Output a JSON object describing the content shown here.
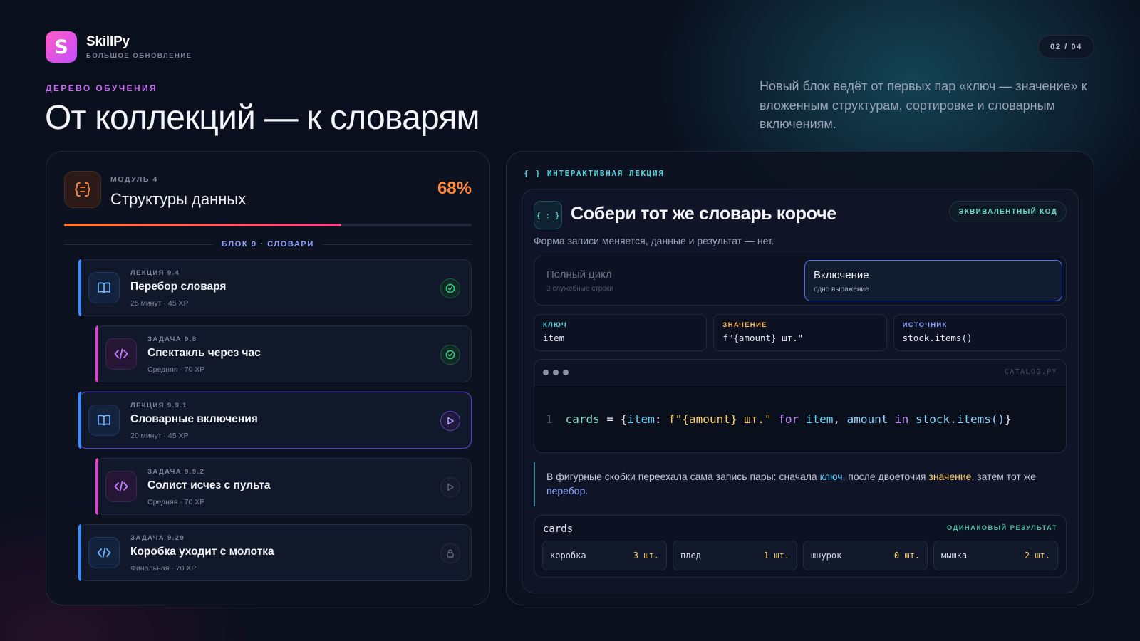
{
  "brand": {
    "name": "SkillPy",
    "subtitle": "БОЛЬШОЕ ОБНОВЛЕНИЕ",
    "logo_letter": "S"
  },
  "pager": "02 / 04",
  "hero": {
    "kicker": "ДЕРЕВО ОБУЧЕНИЯ",
    "title": "От коллекций — к словарям",
    "lede": "Новый блок ведёт от первых пар «ключ — значение» к вложенным структурам, сортировке и словарным включениям."
  },
  "module": {
    "kicker": "МОДУЛЬ 4",
    "title": "Структуры данных",
    "progress_label": "68%",
    "progress": 0.68,
    "icon": "braces-doc-icon",
    "block_label": "БЛОК 9 · СЛОВАРИ",
    "items": [
      {
        "kind": "lesson",
        "kicker": "ЛЕКЦИЯ 9.4",
        "title": "Перебор словаря",
        "meta": "25 минут · 45 XP",
        "status": "done",
        "icon": "book-icon"
      },
      {
        "kind": "task",
        "kicker": "ЗАДАЧА 9.8",
        "title": "Спектакль через час",
        "meta": "Средняя · 70 XP",
        "status": "done",
        "icon": "code-icon"
      },
      {
        "kind": "lesson",
        "kicker": "ЛЕКЦИЯ 9.9.1",
        "title": "Словарные включения",
        "meta": "20 минут · 45 XP",
        "status": "play",
        "icon": "book-icon"
      },
      {
        "kind": "task",
        "kicker": "ЗАДАЧА 9.9.2",
        "title": "Солист исчез с пульта",
        "meta": "Средняя · 70 XP",
        "status": "next",
        "icon": "code-icon"
      },
      {
        "kind": "final",
        "kicker": "ЗАДАЧА 9.20",
        "title": "Коробка уходит с молотка",
        "meta": "Финальная · 70 XP",
        "status": "lock",
        "icon": "code-icon"
      }
    ]
  },
  "lecture": {
    "kicker": "{ }  ИНТЕРАКТИВНАЯ ЛЕКЦИЯ",
    "icon_text": "{ : }",
    "title": "Собери тот же словарь короче",
    "subtitle": "Форма записи меняется, данные и результат — нет.",
    "badge": "ЭКВИВАЛЕНТНЫЙ КОД",
    "options": [
      {
        "label": "Полный цикл",
        "hint": "3 служебные строки",
        "selected": false
      },
      {
        "label": "Включение",
        "hint": "одно выражение",
        "selected": true
      }
    ],
    "fields": [
      {
        "key": "КЛЮЧ",
        "value": "item",
        "color": "#4fd4dc"
      },
      {
        "key": "ЗНАЧЕНИЕ",
        "value": "f\"{amount} шт.\"",
        "color": "#ffb347"
      },
      {
        "key": "ИСТОЧНИК",
        "value": "stock.items()",
        "color": "#8fa3ff"
      }
    ],
    "code": {
      "file": "CATALOG.PY",
      "line_number": "1",
      "tokens": [
        {
          "t": "cards",
          "c": "c-fn"
        },
        {
          "t": " = {",
          "c": "c-op"
        },
        {
          "t": "item",
          "c": "c-name"
        },
        {
          "t": ": ",
          "c": "c-op"
        },
        {
          "t": "f\"{amount} шт.\"",
          "c": "c-str"
        },
        {
          "t": " for ",
          "c": "c-kw"
        },
        {
          "t": "item",
          "c": "c-name"
        },
        {
          "t": ", ",
          "c": "c-op"
        },
        {
          "t": "amount",
          "c": "c-var"
        },
        {
          "t": " in ",
          "c": "c-kw"
        },
        {
          "t": "stock.items()",
          "c": "c-var"
        },
        {
          "t": "}",
          "c": "c-op"
        }
      ]
    },
    "note": {
      "before": "В фигурные скобки переехала сама запись пары: сначала ",
      "key": "ключ",
      "mid1": ", после двоеточия ",
      "value": "значение",
      "mid2": ", затем тот же ",
      "source": "перебор",
      "after": "."
    },
    "result": {
      "name": "cards",
      "tag": "ОДИНАКОВЫЙ РЕЗУЛЬТАТ",
      "items": [
        {
          "key": "коробка",
          "value": "3 шт."
        },
        {
          "key": "плед",
          "value": "1 шт."
        },
        {
          "key": "шнурок",
          "value": "0 шт."
        },
        {
          "key": "мышка",
          "value": "2 шт."
        }
      ]
    }
  }
}
